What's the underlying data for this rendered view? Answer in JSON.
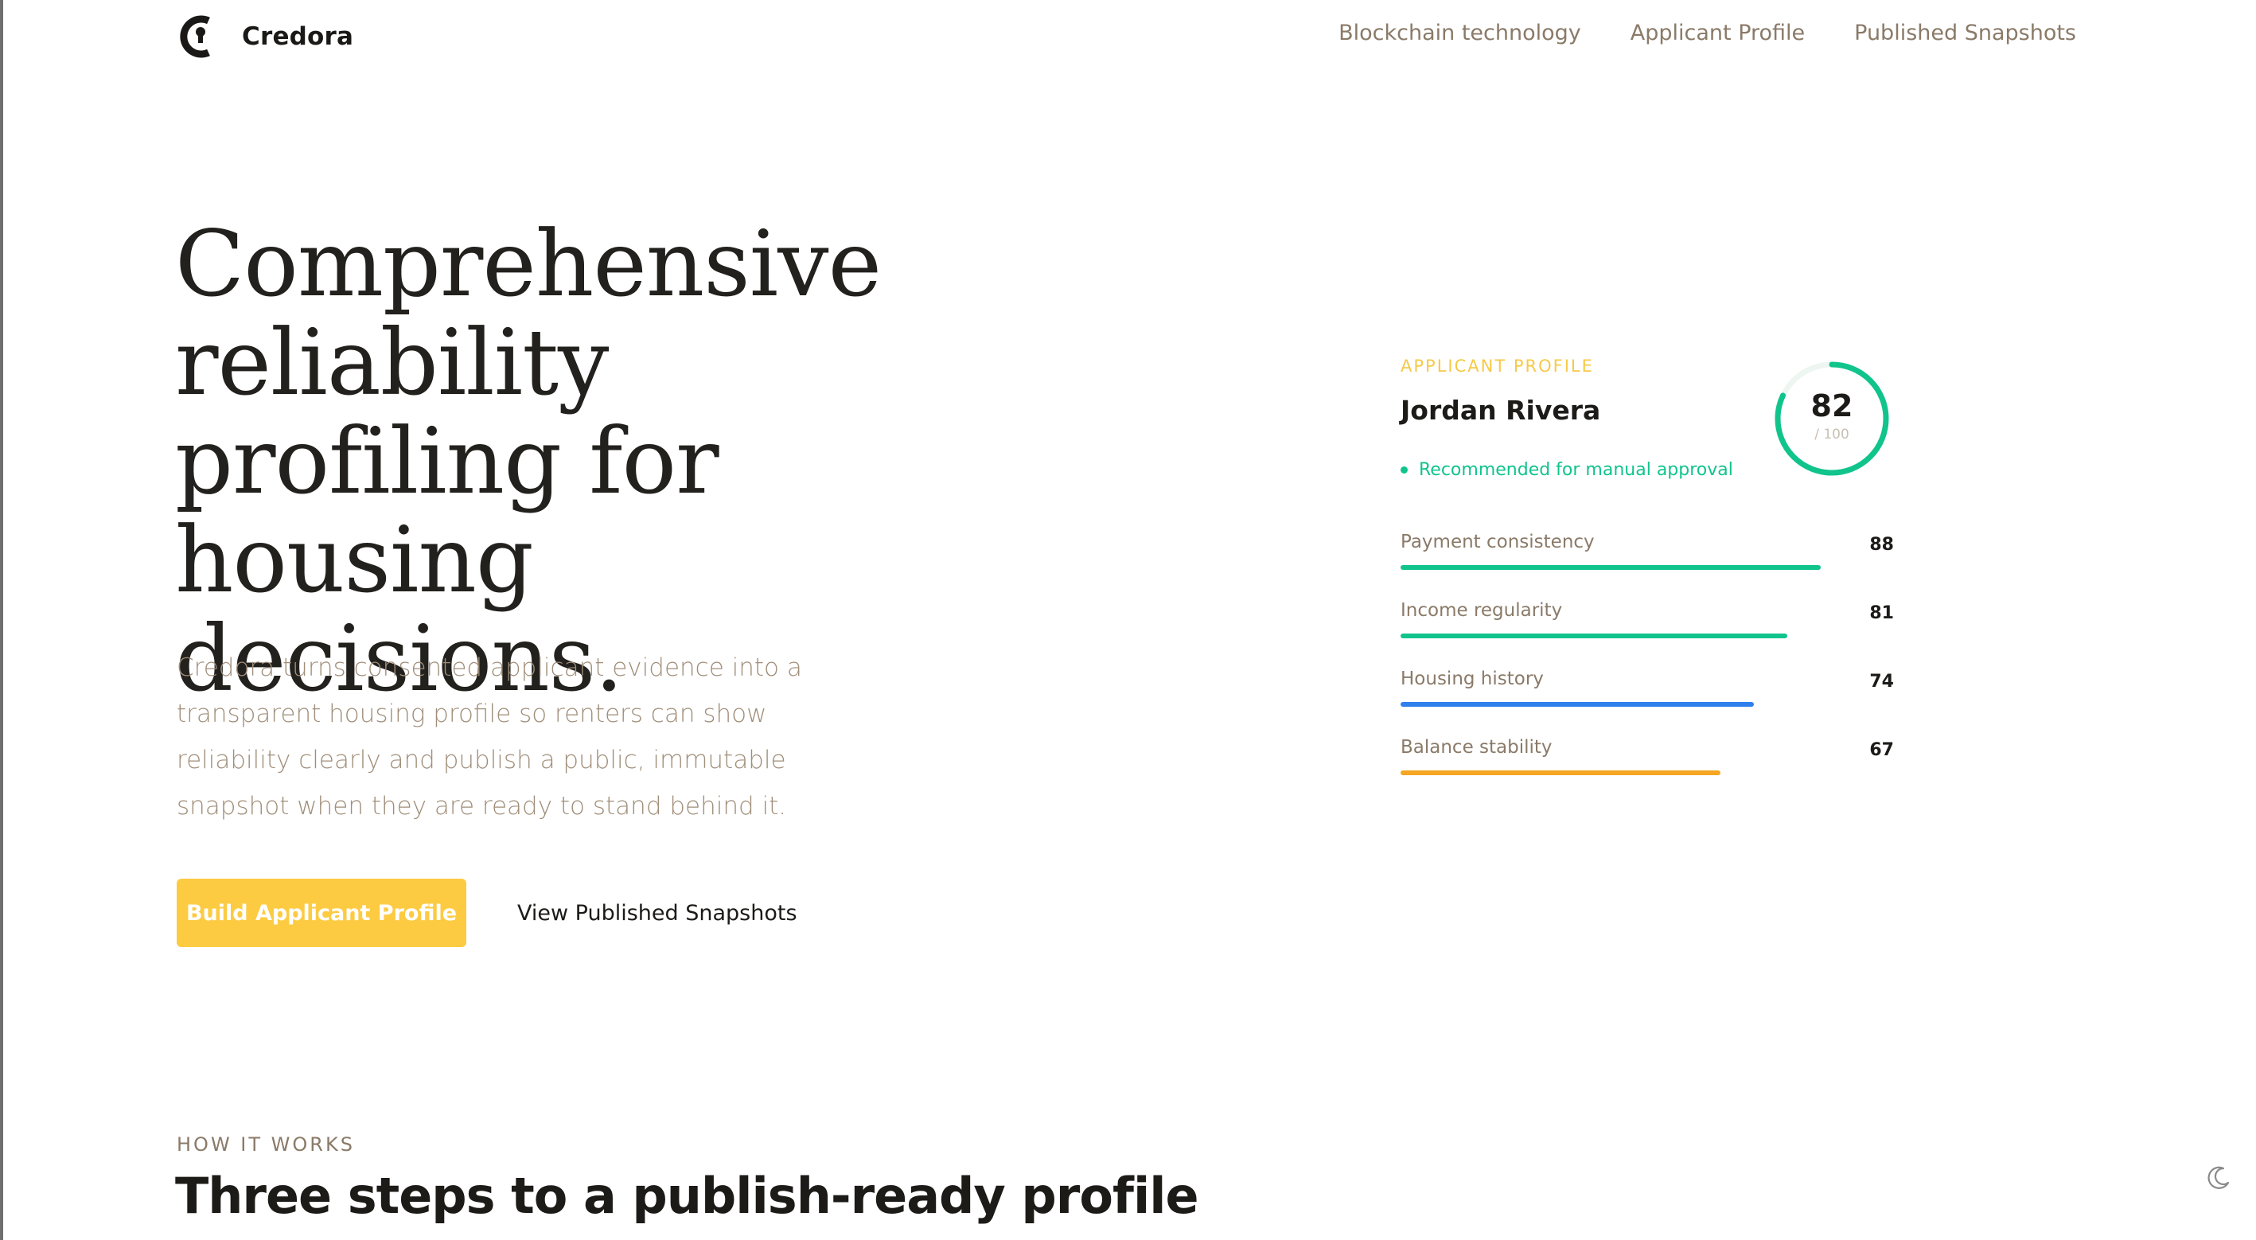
{
  "brand": {
    "name": "Credora"
  },
  "nav": {
    "items": [
      "Blockchain technology",
      "Applicant Profile",
      "Published Snapshots"
    ]
  },
  "hero": {
    "title": "Comprehensive reliability profiling for housing decisions.",
    "subtitle": "Credora turns consented applicant evidence into a transparent housing profile so renters can show reliability clearly and publish a public, immutable snapshot when they are ready to stand behind it.",
    "primary_cta": "Build Applicant Profile",
    "secondary_cta": "View Published Snapshots"
  },
  "profile_card": {
    "eyebrow": "APPLICANT PROFILE",
    "name": "Jordan Rivera",
    "recommendation": "Recommended for manual approval",
    "score": "82",
    "score_value": 82,
    "score_max": "/ 100",
    "metrics": [
      {
        "label": "Payment consistency",
        "value": "88",
        "level": 0.88,
        "color": "#10c48c"
      },
      {
        "label": "Income regularity",
        "value": "81",
        "level": 0.81,
        "color": "#10c48c"
      },
      {
        "label": "Housing history",
        "value": "74",
        "level": 0.74,
        "color": "#2f80ed"
      },
      {
        "label": "Balance stability",
        "value": "67",
        "level": 0.67,
        "color": "#f5a623"
      }
    ]
  },
  "how_it_works": {
    "eyebrow": "HOW IT WORKS",
    "title": "Three steps to a publish-ready profile"
  },
  "icons": {
    "theme_toggle": "moon-icon",
    "brand_logo": "credora-logo-icon"
  },
  "colors": {
    "accent": "#fccb42",
    "success": "#10c48c",
    "muted_text": "#8a7a68"
  }
}
